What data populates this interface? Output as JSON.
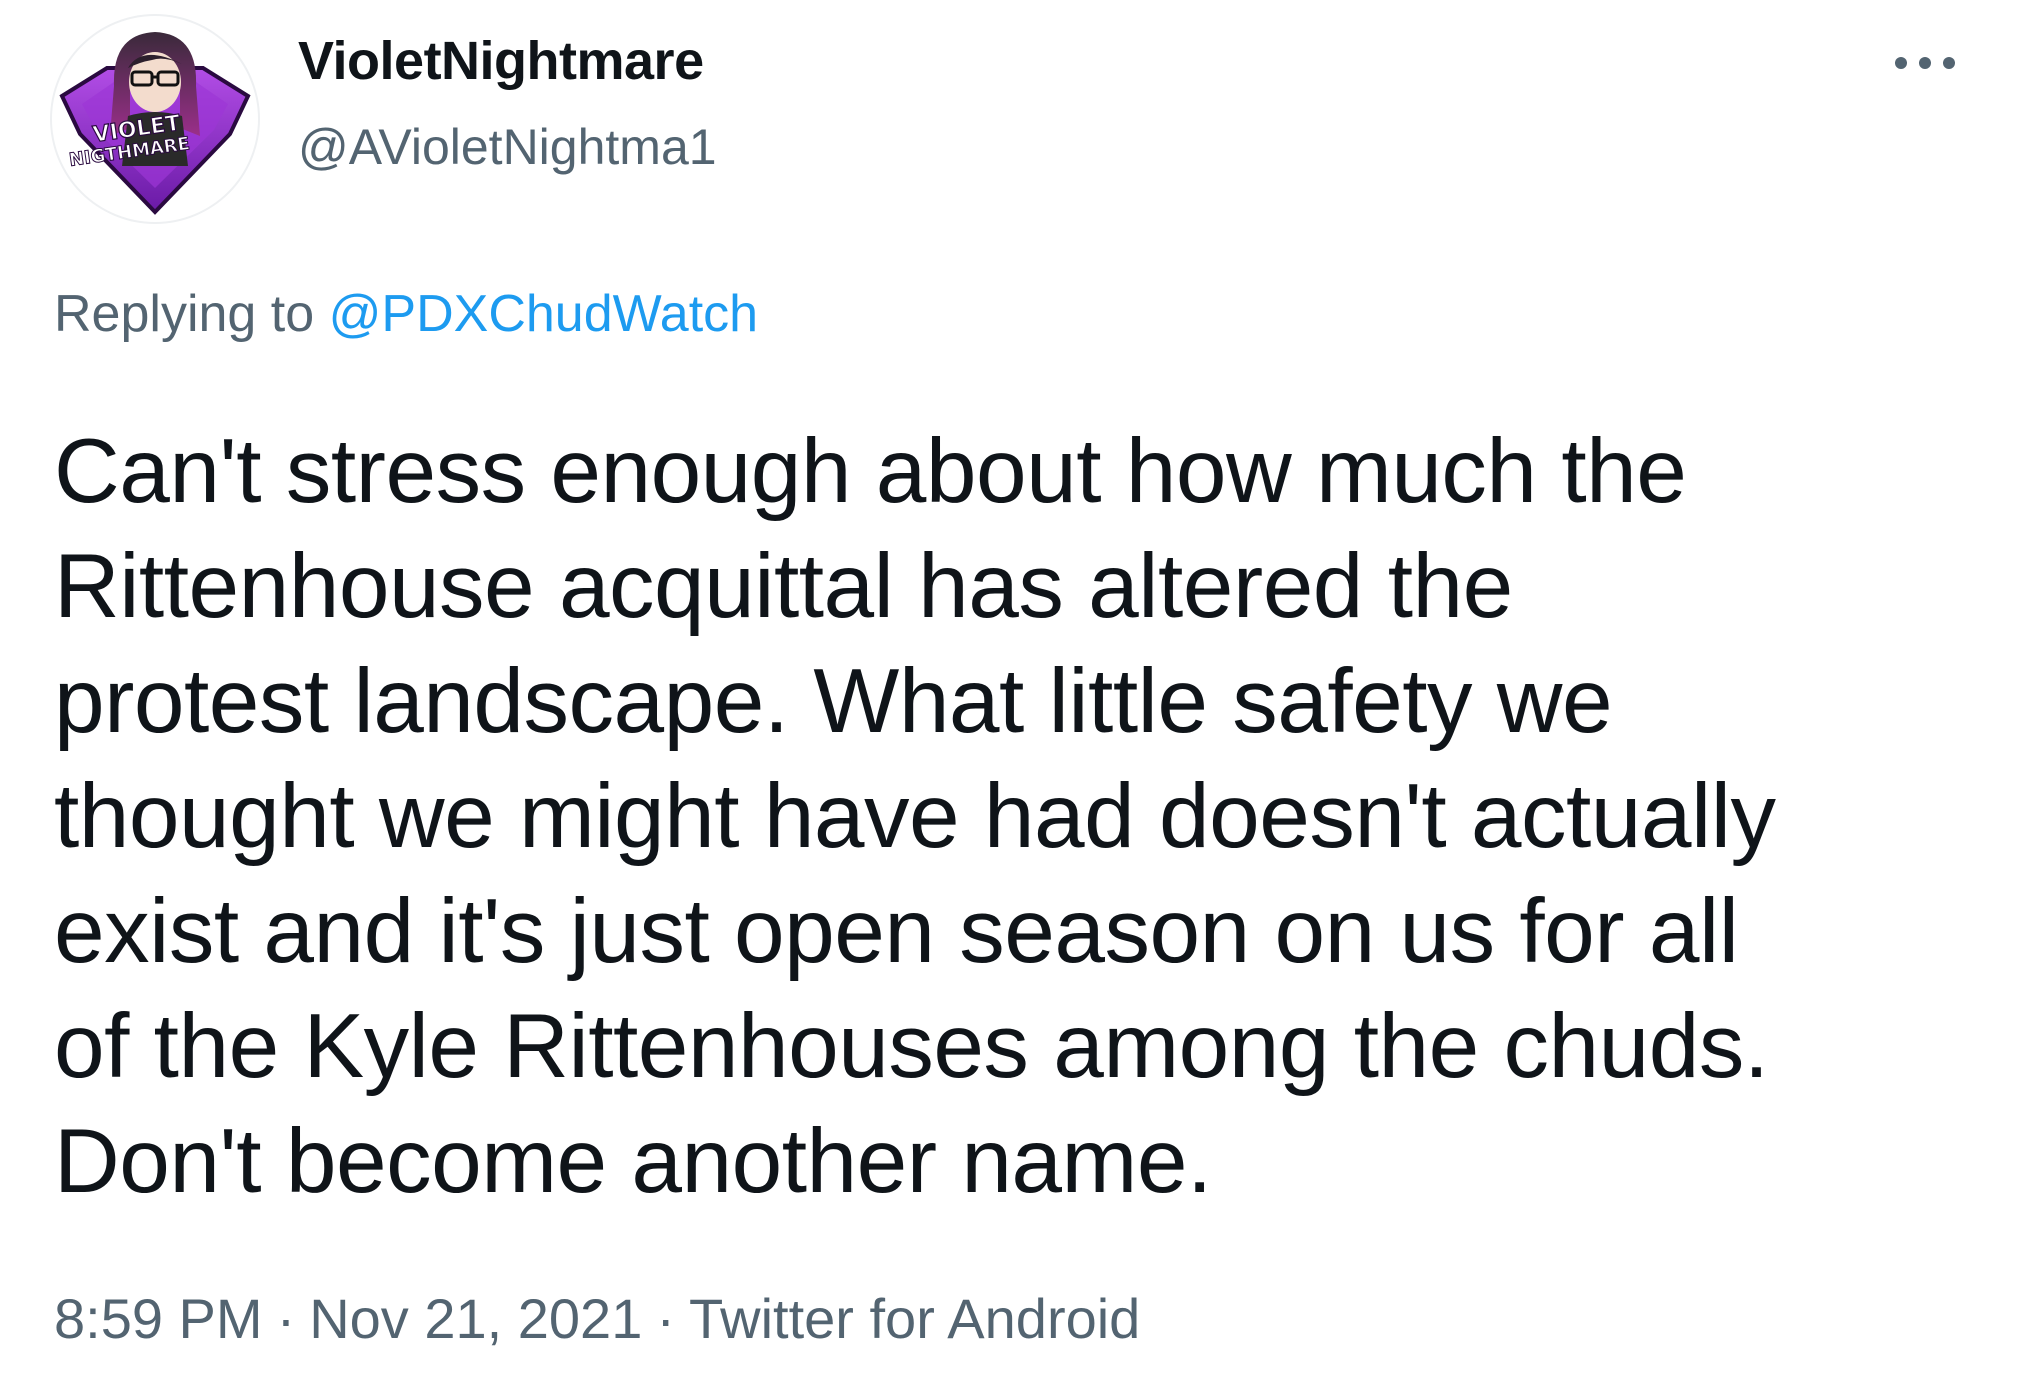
{
  "user": {
    "display_name": "VioletNightmare",
    "handle": "@AVioletNightma1",
    "avatar_text_line1": "VIOLET",
    "avatar_text_line2": "NIGTHMARE"
  },
  "reply": {
    "prefix": "Replying to",
    "mention": "@PDXChudWatch"
  },
  "tweet": {
    "lines": [
      "Can't stress enough about how much the",
      "Rittenhouse acquittal has altered the",
      "protest landscape. What little safety we",
      "thought we might have had doesn't actually",
      "exist and it's just open season on us for all",
      "of the Kyle Rittenhouses among the chuds.",
      "Don't become another name."
    ]
  },
  "meta": {
    "time": "8:59 PM",
    "separator": "·",
    "date": "Nov 21, 2021",
    "source": "Twitter for Android"
  },
  "icons": {
    "more": "more-horizontal-icon"
  },
  "colors": {
    "text": "#0f1419",
    "secondary": "#536471",
    "link": "#1d9bf0",
    "avatar_purple": "#8b2fc9"
  }
}
